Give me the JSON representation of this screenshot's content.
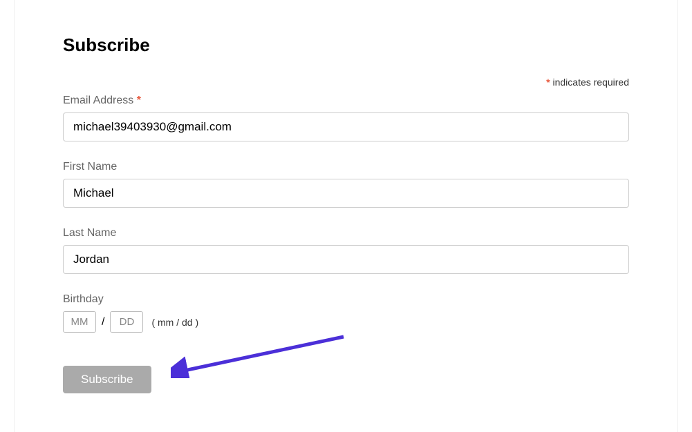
{
  "form": {
    "title": "Subscribe",
    "required_note": " indicates required",
    "asterisk": "*",
    "fields": {
      "email": {
        "label": "Email Address ",
        "value": "michael39403930@gmail.com"
      },
      "first_name": {
        "label": "First Name",
        "value": "Michael"
      },
      "last_name": {
        "label": "Last Name",
        "value": "Jordan"
      },
      "birthday": {
        "label": "Birthday",
        "mm_placeholder": "MM",
        "dd_placeholder": "DD",
        "slash": "/",
        "hint": "( mm / dd )"
      }
    },
    "submit_label": "Subscribe"
  },
  "annotation": {
    "arrow_color": "#4b2fd8"
  }
}
